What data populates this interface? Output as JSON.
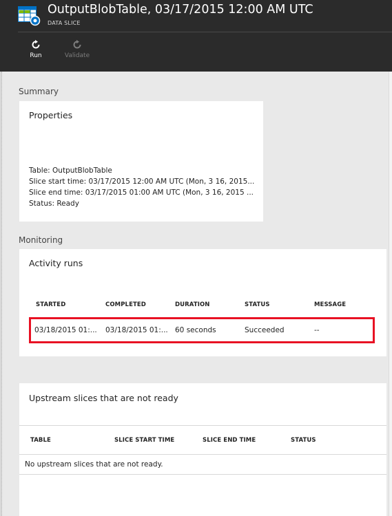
{
  "header": {
    "title": "OutputBlobTable, 03/17/2015 12:00 AM UTC",
    "subtitle": "DATA SLICE",
    "icon": "table-slice-icon",
    "commands": [
      {
        "label": "Run",
        "icon": "refresh-icon",
        "enabled": true
      },
      {
        "label": "Validate",
        "icon": "refresh-icon",
        "enabled": false
      }
    ]
  },
  "summary": {
    "section_label": "Summary",
    "properties": {
      "title": "Properties",
      "lines": [
        "Table: OutputBlobTable",
        "Slice start time: 03/17/2015 12:00 AM UTC (Mon, 3 16, 2015...",
        "Slice end time: 03/17/2015 01:00 AM UTC (Mon, 3 16, 2015 ...",
        "Status: Ready"
      ]
    }
  },
  "monitoring": {
    "section_label": "Monitoring",
    "activity_runs": {
      "title": "Activity runs",
      "columns": [
        "STARTED",
        "COMPLETED",
        "DURATION",
        "STATUS",
        "MESSAGE"
      ],
      "rows": [
        [
          "03/18/2015 01:...",
          "03/18/2015 01:...",
          "60 seconds",
          "Succeeded",
          "--"
        ]
      ]
    }
  },
  "upstream": {
    "title": "Upstream slices that are not ready",
    "columns": [
      "TABLE",
      "SLICE START TIME",
      "SLICE END TIME",
      "STATUS"
    ],
    "empty_message": "No upstream slices that are not ready."
  },
  "colors": {
    "header_bg": "#2b2b2b",
    "content_bg": "#e9e9e9",
    "highlight": "#e81123",
    "icon_blue": "#0072c6"
  }
}
